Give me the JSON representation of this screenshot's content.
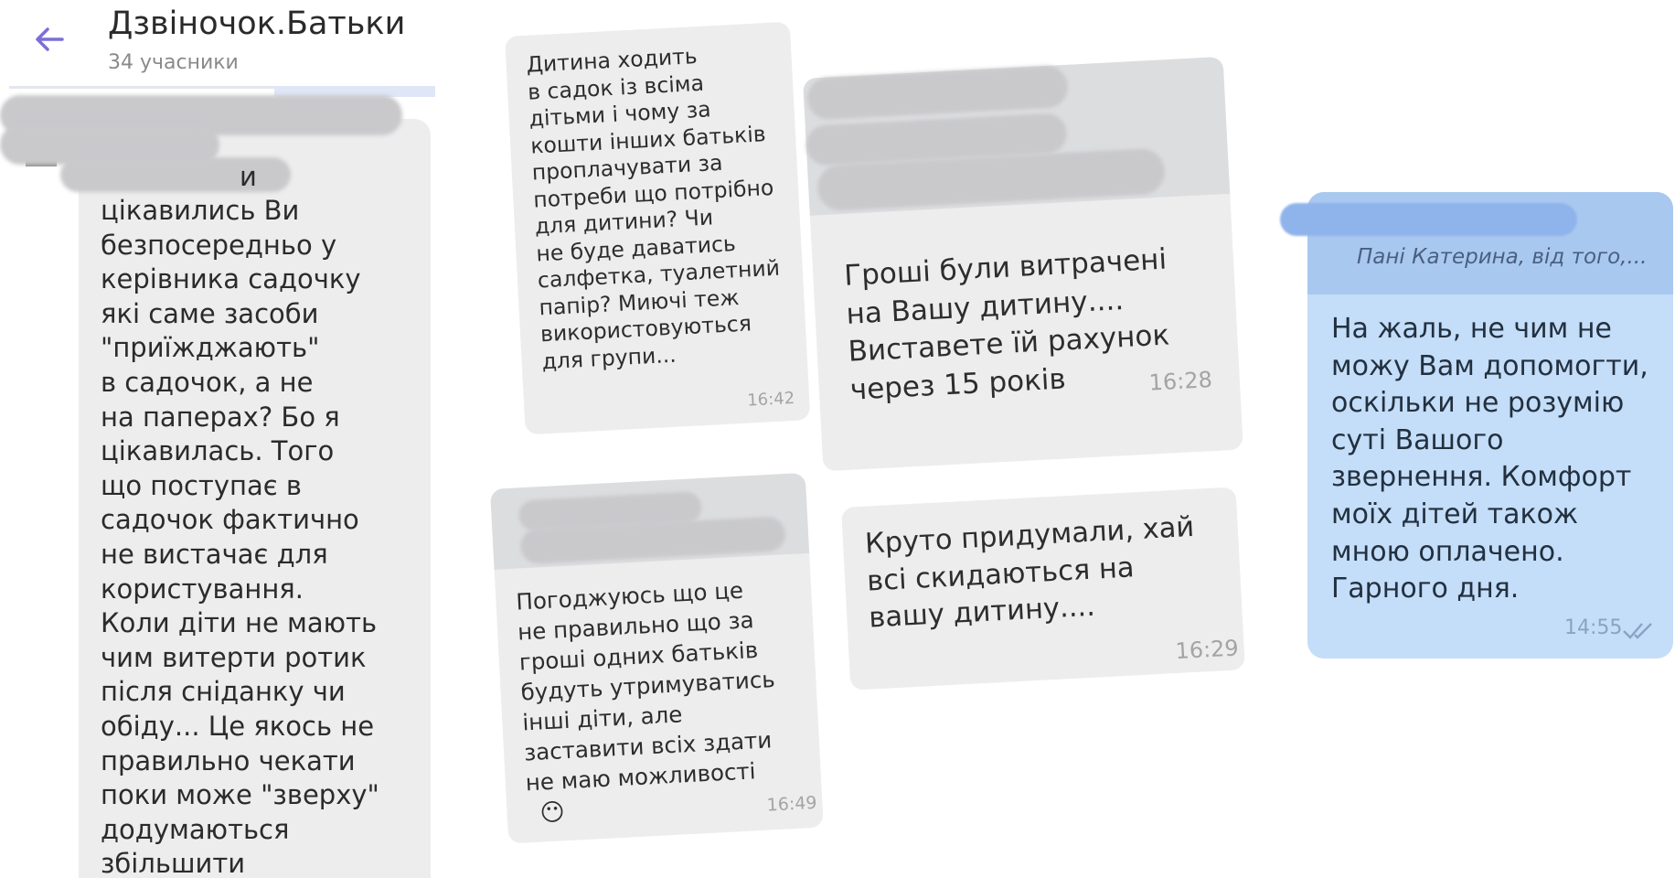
{
  "header": {
    "title": "Дзвіночок.Батьки",
    "subtitle": "34 учасники"
  },
  "messages": {
    "long": {
      "tail": "и",
      "text": "цікавились Ви\nбезпосередньо у\nкерівника садочку\nякі саме засоби\n\"приїжджають\"\nв садочок, а не\nна паперах? Бо я\nцікавилась. Того\nщо поступає в\nсадочок фактично\nне вистачає для\nкористування.\nКоли діти не мають\nчим витерти ротик\nпісля сніданку чи\nобіду... Це якось не\nправильно чекати\nпоки може \"зверху\"\nдодумаються\nзбільшити"
    },
    "m1642": {
      "text": "Дитина  ходить\nв садок із всіма\nдітьми і чому за\nкошти інших батьків\nпроплачувати за\nпотреби що потрібно\nдля дитини? Чи\nне буде даватись\nсалфетка, туалетний\nпапір? Миючі теж\nвикористовуються\nдля групи...",
      "time": "16:42"
    },
    "m1649": {
      "text": "Погоджуюсь що це\nне правильно що за\nгроші одних батьків\nбудуть утримуватись\nінші діти, але\nзаставити всіх здати\nне маю можливості",
      "emoji": "😶",
      "time": "16:49"
    },
    "m1628": {
      "text": "Гроші були витрачені\nна Вашу дитину....\nВиставете їй рахунок\nчерез 15 років",
      "time": "16:28"
    },
    "m1629": {
      "text": "Круто придумали, хай\nвсі скидаються на\nвашу дитину....",
      "time": "16:29"
    },
    "out1455": {
      "reply_preview": "Пані Катерина, від того,...",
      "text": "На жаль, не чим не\nможу Вам допомогти,\nоскільки не розумію\nсуті Вашого\nзвернення. Комфорт\nмоїх дітей також\nмною оплачено.\nГарного дня.",
      "time": "14:55"
    }
  },
  "icons": {
    "back": "arrow-left-icon",
    "read_receipt": "double-check-icon"
  },
  "colors": {
    "accent": "#7b6fd6",
    "incoming_bubble": "#ededee",
    "outgoing_bubble": "#c4ddf8",
    "redaction": "#c9c9cc"
  }
}
